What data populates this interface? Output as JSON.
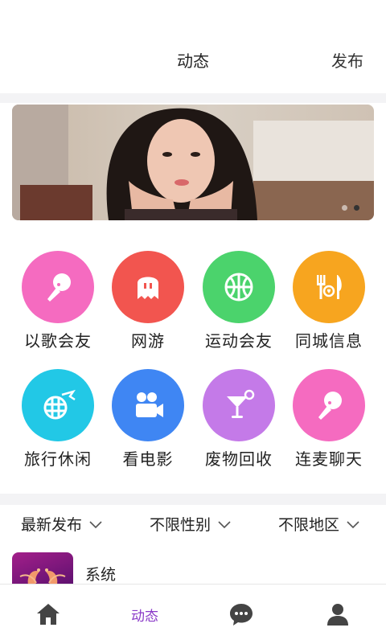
{
  "header": {
    "title": "动态",
    "publish_label": "发布"
  },
  "banner": {
    "dots_count": 2,
    "active_dot": 1
  },
  "categories": [
    {
      "label": "以歌会友",
      "icon": "microphone-icon",
      "color": "#f56bc0"
    },
    {
      "label": "网游",
      "icon": "ghost-icon",
      "color": "#f2554f"
    },
    {
      "label": "运动会友",
      "icon": "basketball-icon",
      "color": "#4bd36c"
    },
    {
      "label": "同城信息",
      "icon": "dining-icon",
      "color": "#f7a51f"
    },
    {
      "label": "旅行休闲",
      "icon": "globe-plane-icon",
      "color": "#22c8e6"
    },
    {
      "label": "看电影",
      "icon": "movie-camera-icon",
      "color": "#3f86f3"
    },
    {
      "label": "废物回收",
      "icon": "cocktail-icon",
      "color": "#c47ae8"
    },
    {
      "label": "连麦聊天",
      "icon": "microphone-icon",
      "color": "#f56bc0"
    }
  ],
  "filters": [
    {
      "label": "最新发布"
    },
    {
      "label": "不限性别"
    },
    {
      "label": "不限地区"
    }
  ],
  "post": {
    "name": "系统"
  },
  "tabbar": {
    "active_label": "动态",
    "active_color": "#8a3ac8"
  }
}
